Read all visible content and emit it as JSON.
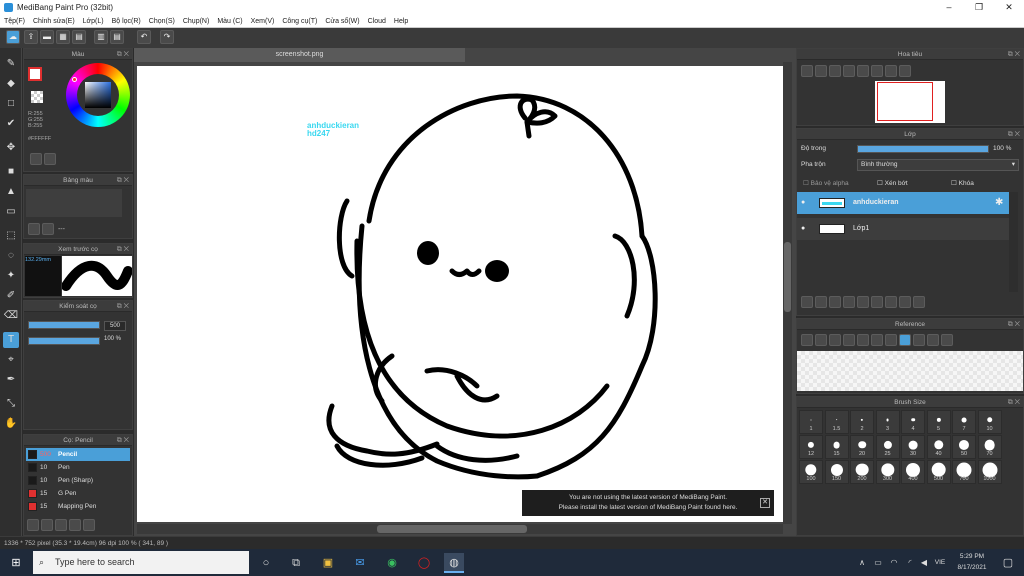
{
  "window": {
    "title": "MediBang Paint Pro (32bit)",
    "controls": [
      "–",
      "❐",
      "✕"
    ]
  },
  "menu": [
    "Tệp(F)",
    "Chỉnh sửa(E)",
    "Lớp(L)",
    "Bộ lọc(R)",
    "Chọn(S)",
    "Chụp(N)",
    "Màu (C)",
    "Xem(V)",
    "Công cụ(T)",
    "Cửa sổ(W)",
    "Cloud",
    "Help"
  ],
  "color_panel": {
    "title": "Màu",
    "rgb": [
      "R:255",
      "G:255",
      "B:255"
    ],
    "hex": "#FFFFFF"
  },
  "palette_panel": {
    "title": "Bảng màu",
    "empty": "---"
  },
  "preview_panel": {
    "title": "Xem trước cọ",
    "size": "132.29mm"
  },
  "control_panel": {
    "title": "Kiểm soát cọ",
    "size_value": "500",
    "opacity_value": "100 %"
  },
  "brush_panel": {
    "title": "Cọ: Pencil",
    "brushes": [
      {
        "size": "500",
        "name": "Pencil",
        "color": "#1a1a1a",
        "active": true
      },
      {
        "size": "10",
        "name": "Pen",
        "color": "#1a1a1a",
        "active": false
      },
      {
        "size": "10",
        "name": "Pen (Sharp)",
        "color": "#1a1a1a",
        "active": false
      },
      {
        "size": "15",
        "name": "G Pen",
        "color": "#e03030",
        "active": false
      },
      {
        "size": "15",
        "name": "Mapping Pen",
        "color": "#e03030",
        "active": false
      }
    ]
  },
  "canvas": {
    "tab": "screenshot.png",
    "watermark_line1": "anhduckieran",
    "watermark_line2": "hd247"
  },
  "notice": {
    "line1": "You are not using the latest version of MediBang Paint.",
    "line2": "Please install the latest version of MediBang Paint found here.",
    "close": "✕"
  },
  "navigator": {
    "title": "Hoa tiêu"
  },
  "layer_panel": {
    "title": "Lớp",
    "opacity_label": "Độ trong",
    "opacity_value": "100 %",
    "blend_label": "Pha trộn",
    "blend_value": "Bình thường",
    "protect_alpha": "Bảo vệ alpha",
    "clipping": "Xén bớt",
    "lock": "Khóa",
    "layers": [
      {
        "name": "anhduckieran",
        "active": true
      },
      {
        "name": "Lớp1",
        "active": false
      }
    ]
  },
  "reference_panel": {
    "title": "Reference"
  },
  "brush_size_panel": {
    "title": "Brush Size",
    "sizes": [
      "1",
      "1.5",
      "2",
      "3",
      "4",
      "5",
      "7",
      "10",
      "12",
      "15",
      "20",
      "25",
      "30",
      "40",
      "50",
      "70",
      "100",
      "150",
      "200",
      "300",
      "400",
      "500",
      "700",
      "1000"
    ]
  },
  "status": {
    "text": "1336 * 752 pixel  (35.3 * 19.4cm)  96 dpi  100 %  ( 341, 89 )"
  },
  "taskbar": {
    "search_placeholder": "Type here to search",
    "lang": "VIE",
    "time": "5:29 PM",
    "date": "8/17/2021"
  }
}
